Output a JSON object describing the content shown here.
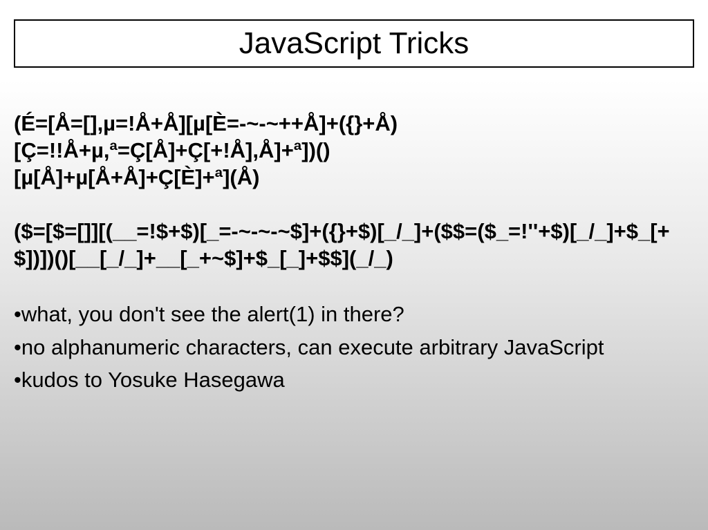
{
  "title": "JavaScript Tricks",
  "code1_line1": "(É=[Å=[],µ=!Å+Å][µ[È=-~-~++Å]+({}+Å)",
  "code1_line2": "[Ç=!!Å+µ,ª=Ç[Å]+Ç[+!Å],Å]+ª])()",
  "code1_line3": "[µ[Å]+µ[Å+Å]+Ç[È]+ª](Å)",
  "code2_line1": "($=[$=[]][(__=!$+$)[_=-~-~-~$]+({}+$)[_/_]+($$=($_=!''+$)[_/_]+$_[+$])])()[__[_/_]+__[_+~$]+$_[_]+$$](_/_)",
  "bullets": [
    "what, you don't see the alert(1) in there?",
    "no alphanumeric characters, can execute arbitrary JavaScript",
    "kudos to Yosuke Hasegawa"
  ]
}
